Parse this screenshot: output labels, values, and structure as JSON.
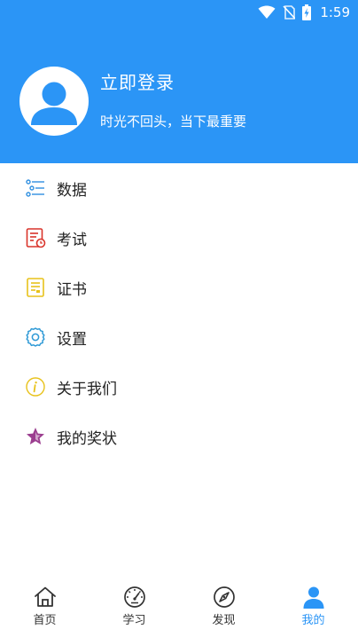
{
  "status_bar": {
    "time": "1:59"
  },
  "profile": {
    "login_label": "立即登录",
    "motto": "时光不回头，当下最重要"
  },
  "menu": {
    "items": [
      {
        "label": "数据",
        "icon": "list-icon",
        "color": "#2f8fe0"
      },
      {
        "label": "考试",
        "icon": "exam-icon",
        "color": "#d9342b"
      },
      {
        "label": "证书",
        "icon": "certificate-icon",
        "color": "#e8c21a"
      },
      {
        "label": "设置",
        "icon": "gear-icon",
        "color": "#2f9ad6"
      },
      {
        "label": "关于我们",
        "icon": "info-icon",
        "color": "#e8c21a"
      },
      {
        "label": "我的奖状",
        "icon": "star-award-icon",
        "color": "#9b3d8f"
      }
    ]
  },
  "bottom_nav": {
    "items": [
      {
        "label": "首页",
        "icon": "home-icon"
      },
      {
        "label": "学习",
        "icon": "speedometer-icon"
      },
      {
        "label": "发现",
        "icon": "compass-icon"
      },
      {
        "label": "我的",
        "icon": "person-icon",
        "active": true
      }
    ]
  },
  "colors": {
    "primary": "#2b95f6"
  }
}
